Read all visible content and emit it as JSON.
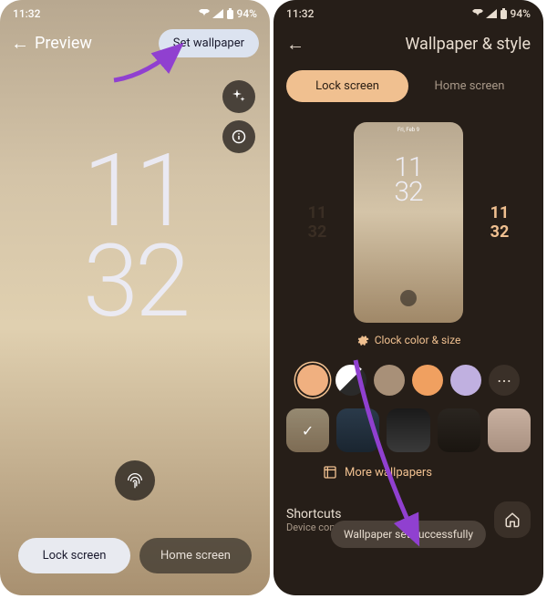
{
  "status": {
    "time": "11:32",
    "battery": "94%"
  },
  "left": {
    "title": "Preview",
    "set_wallpaper": "Set wallpaper",
    "clock": {
      "h": "11",
      "m": "32"
    },
    "tabs": {
      "lock": "Lock screen",
      "home": "Home screen"
    }
  },
  "right": {
    "title": "Wallpaper & style",
    "tabs": {
      "lock": "Lock screen",
      "home": "Home screen"
    },
    "preview_status": "Fri, Feb 9",
    "preview_clock": {
      "h": "11",
      "m": "32"
    },
    "clock_styles": {
      "s1h": "11",
      "s1m": "32",
      "s2h": "11",
      "s2m": "32"
    },
    "clock_color_size": "Clock color & size",
    "swatches": [
      "#f0b080",
      "#f4f4f4",
      "#a89078",
      "#f0a060",
      "#c0b0e0"
    ],
    "more_wallpapers": "More wallpapers",
    "toast": "Wallpaper set successfully",
    "shortcuts": {
      "title": "Shortcuts",
      "sub": "Device controls"
    }
  }
}
